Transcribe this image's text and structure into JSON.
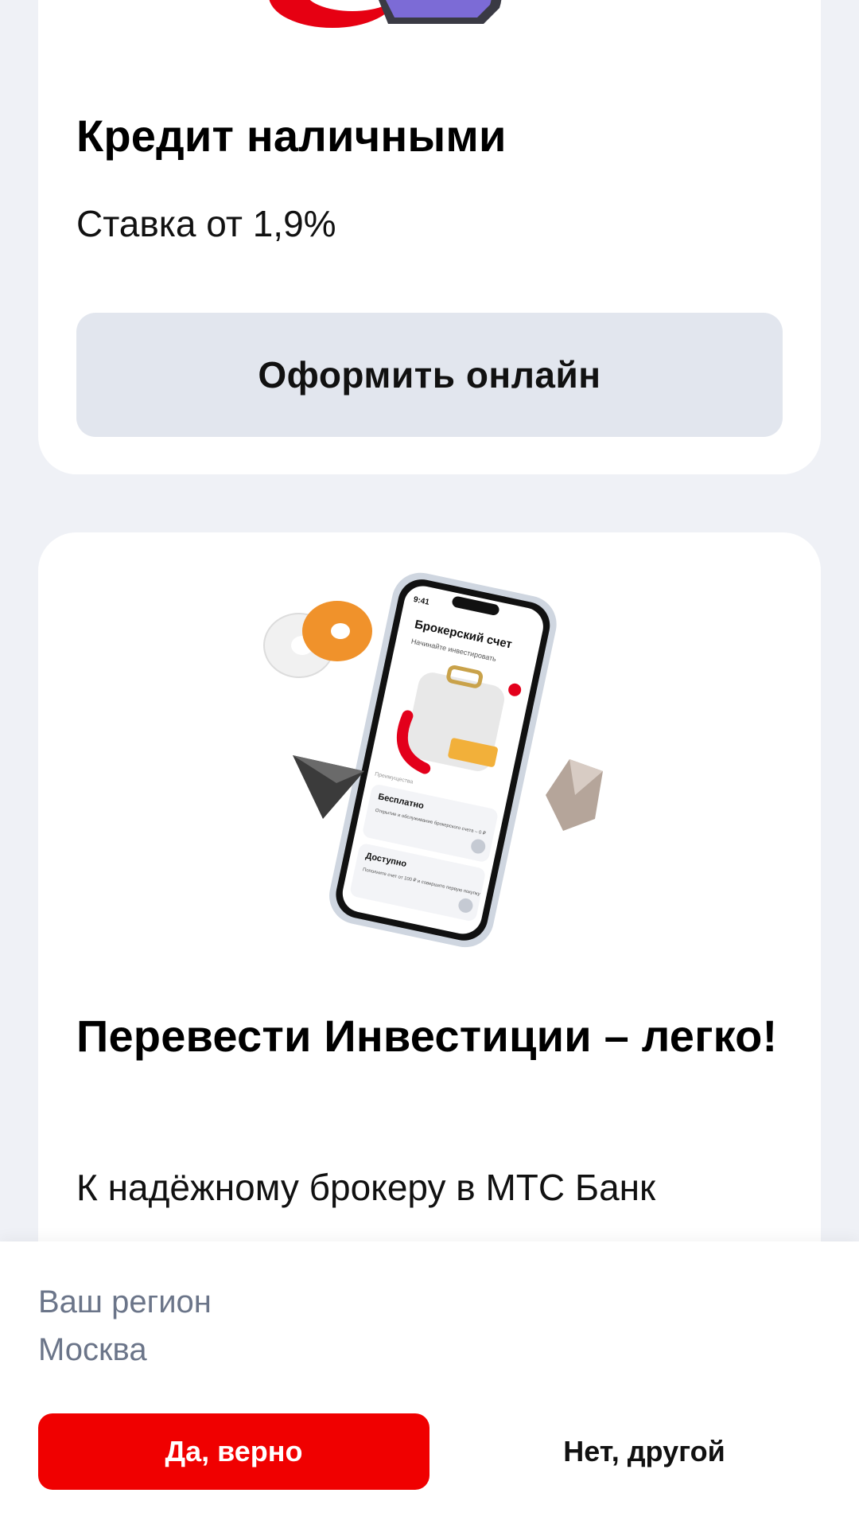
{
  "colors": {
    "page_background": "#eff1f6",
    "card_background": "#ffffff",
    "secondary_button": "#e2e6ee",
    "accent_red": "#f00000",
    "muted_text": "#6b7589"
  },
  "cards": [
    {
      "title": "Кредит наличными",
      "subtitle": "Ставка от 1,9%",
      "button_label": "Оформить онлайн",
      "image": "credit-illustration"
    },
    {
      "title": "Перевести Инвестиции – легко!",
      "subtitle": "К надёжному брокеру в МТС Банк",
      "image": "phone-illustration",
      "phone_screen": {
        "time": "9:41",
        "heading": "Брокерский счет",
        "subheading": "Начинайте инвестировать",
        "section_label": "Преимущества",
        "items": [
          {
            "title": "Бесплатно",
            "text": "Открытие и обслуживание брокерского счета – 0 ₽"
          },
          {
            "title": "Доступно",
            "text": "Пополните счет от 100 ₽ и совершите первую покупку"
          }
        ]
      }
    }
  ],
  "region_sheet": {
    "label": "Ваш регион",
    "value": "Москва",
    "confirm_label": "Да, верно",
    "other_label": "Нет, другой"
  }
}
